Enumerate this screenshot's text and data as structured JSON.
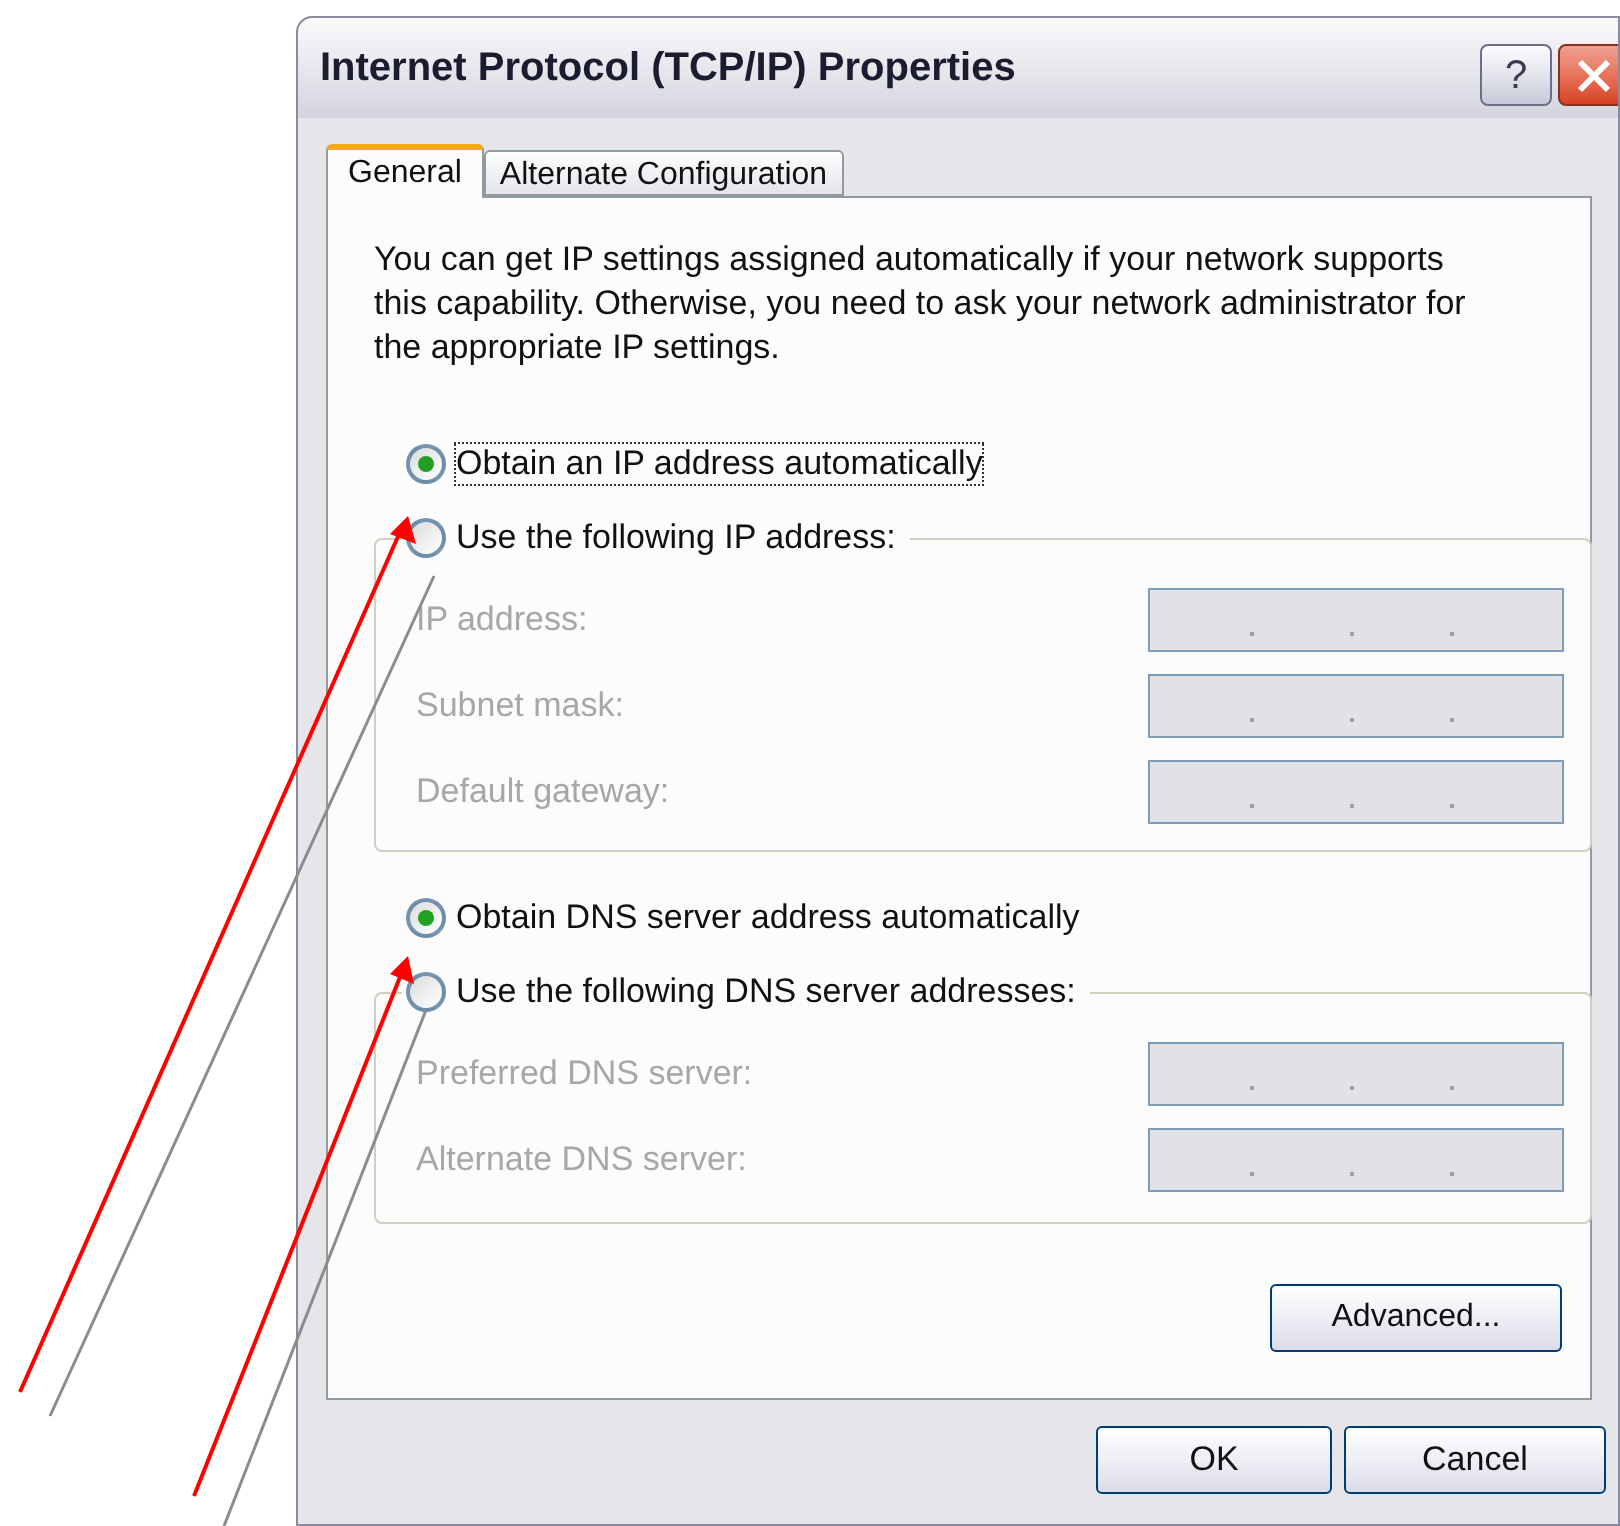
{
  "window": {
    "title": "Internet Protocol (TCP/IP) Properties",
    "help_button": "?"
  },
  "tabs": [
    {
      "label": "General",
      "selected": true
    },
    {
      "label": "Alternate Configuration",
      "selected": false
    }
  ],
  "description": "You can get IP settings assigned automatically if your network supports this capability. Otherwise, you need to ask your network administrator for the appropriate IP settings.",
  "ip_settings": {
    "options": [
      {
        "label": "Obtain an IP address automatically",
        "selected": true,
        "focused": true
      },
      {
        "label": "Use the following IP address:",
        "selected": false,
        "focused": false
      }
    ],
    "fields": [
      {
        "label": "IP address:",
        "disabled": true
      },
      {
        "label": "Subnet mask:",
        "disabled": true
      },
      {
        "label": "Default gateway:",
        "disabled": true
      }
    ]
  },
  "dns_settings": {
    "options": [
      {
        "label": "Obtain DNS server address automatically",
        "selected": true,
        "focused": false
      },
      {
        "label": "Use the following DNS server addresses:",
        "selected": false,
        "focused": false
      }
    ],
    "fields": [
      {
        "label": "Preferred DNS server:",
        "disabled": true
      },
      {
        "label": "Alternate DNS server:",
        "disabled": true
      }
    ]
  },
  "advanced_button": "Advanced...",
  "buttons": [
    "OK",
    "Cancel"
  ]
}
